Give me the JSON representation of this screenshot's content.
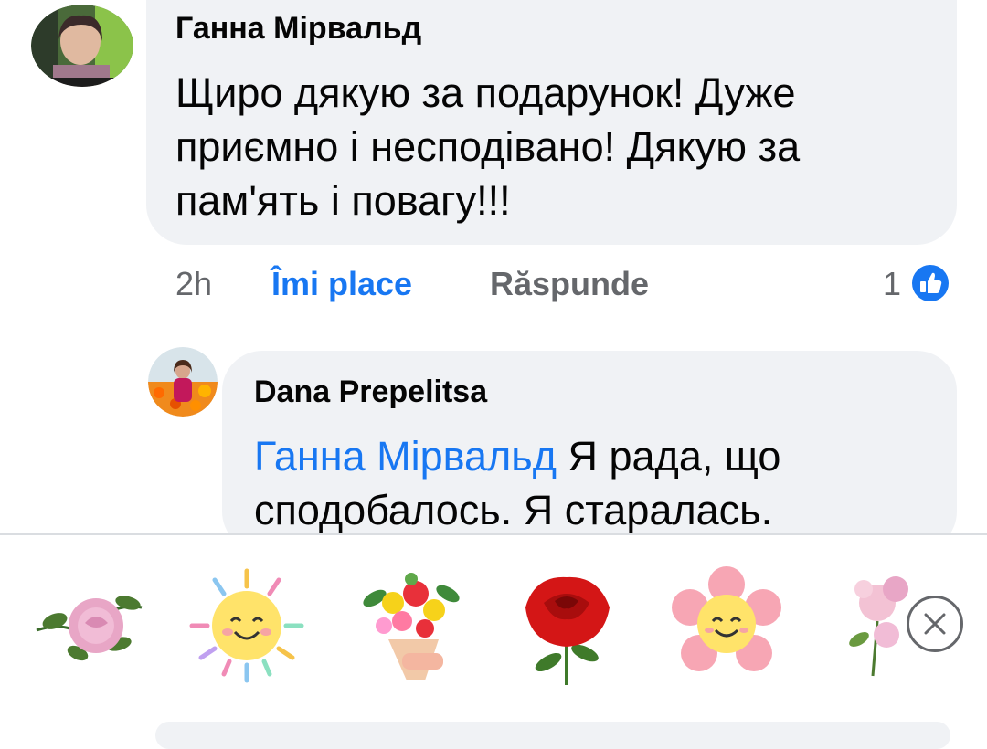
{
  "comment1": {
    "author": "Ганна Мірвальд",
    "text": "Щиро дякую за подарунок! Дуже приємно і несподівано! Дякую за пам'ять і повагу!!!",
    "time": "2h",
    "like_label": "Îmi place",
    "reply_label": "Răspunde",
    "reaction_count": "1"
  },
  "reply1": {
    "author": "Dana Prepelitsa",
    "mention": "Ганна Мірвальд",
    "text": " Я рада, що сподобалось. Я старалась."
  },
  "sticker_tray": {
    "stickers": [
      "rose-sticker",
      "sun-sticker",
      "bouquet-sticker",
      "red-rose-sticker",
      "flower-smile-sticker",
      "pink-flowers-sticker"
    ]
  },
  "colors": {
    "accent": "#1877f2",
    "bubble": "#f0f2f5",
    "muted": "#65676b"
  }
}
